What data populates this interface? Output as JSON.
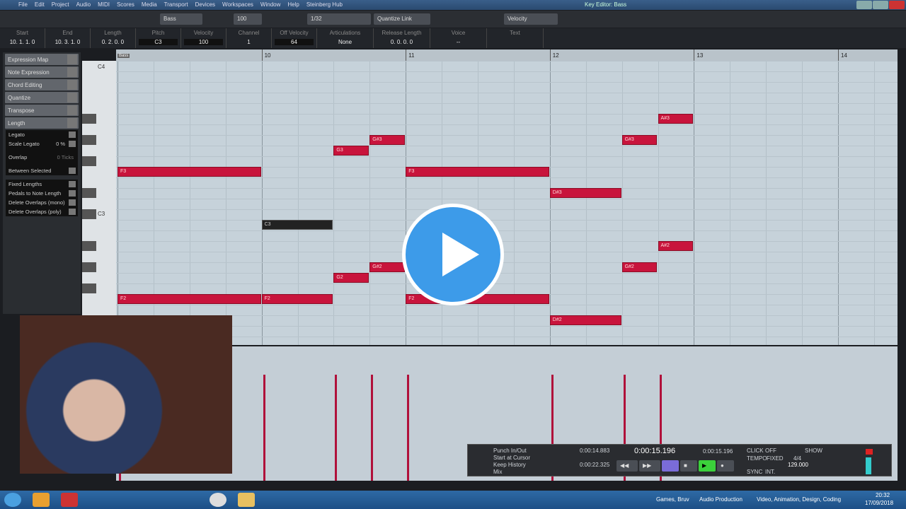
{
  "window": {
    "title": "Key Editor: Bass"
  },
  "menu": [
    "File",
    "Edit",
    "Project",
    "Audio",
    "MIDI",
    "Scores",
    "Media",
    "Transport",
    "Devices",
    "Workspaces",
    "Window",
    "Help",
    "Steinberg Hub"
  ],
  "toolbar": {
    "track": "Bass",
    "velocity": "100",
    "quantize": "1/32",
    "quantize_link": "Quantize Link",
    "controller": "Velocity"
  },
  "infoline": [
    {
      "label": "Start",
      "value": "10. 1. 1.   0"
    },
    {
      "label": "End",
      "value": "10. 3. 1.   0"
    },
    {
      "label": "Length",
      "value": "0. 2. 0.   0"
    },
    {
      "label": "Pitch",
      "value": "C3"
    },
    {
      "label": "Velocity",
      "value": "100"
    },
    {
      "label": "Channel",
      "value": "1"
    },
    {
      "label": "Off Velocity",
      "value": "64"
    },
    {
      "label": "Articulations",
      "value": "None"
    },
    {
      "label": "Release Length",
      "value": "0. 0. 0.   0"
    },
    {
      "label": "Voice",
      "value": "--"
    },
    {
      "label": "Text",
      "value": ""
    }
  ],
  "inspector": {
    "sections": [
      "Expression Map",
      "Note Expression",
      "Chord Editing",
      "Quantize",
      "Transpose",
      "Length"
    ],
    "length_rows": [
      "Legato",
      "Scale Legato",
      "Overlap",
      "Between Selected"
    ],
    "scale_legato": "0 %",
    "overlap": "0 Ticks",
    "functions": [
      "Fixed Lengths",
      "Pedals to Note Length",
      "Delete Overlaps (mono)",
      "Delete Overlaps (poly)"
    ]
  },
  "keys": {
    "c4": "C4",
    "c3": "C3"
  },
  "ruler": {
    "bars": [
      "10",
      "11",
      "12",
      "13",
      "14"
    ],
    "part": "Bass"
  },
  "notes": [
    {
      "pitch": "F3",
      "bar": 9,
      "beat": 1,
      "len": 4
    },
    {
      "pitch": "C3",
      "bar": 10,
      "beat": 1,
      "len": 2,
      "selected": true
    },
    {
      "pitch": "G3",
      "bar": 10,
      "beat": 3,
      "len": 1
    },
    {
      "pitch": "G#3",
      "bar": 10,
      "beat": 4,
      "len": 1
    },
    {
      "pitch": "F3",
      "bar": 11,
      "beat": 1,
      "len": 4
    },
    {
      "pitch": "D#3",
      "bar": 12,
      "beat": 1,
      "len": 2
    },
    {
      "pitch": "G#3",
      "bar": 12,
      "beat": 3,
      "len": 1
    },
    {
      "pitch": "A#3",
      "bar": 12,
      "beat": 4,
      "len": 1
    },
    {
      "pitch": "F2",
      "bar": 9,
      "beat": 1,
      "len": 4
    },
    {
      "pitch": "F2",
      "bar": 10,
      "beat": 1,
      "len": 2
    },
    {
      "pitch": "G2",
      "bar": 10,
      "beat": 3,
      "len": 1
    },
    {
      "pitch": "G#2",
      "bar": 10,
      "beat": 4,
      "len": 1
    },
    {
      "pitch": "F2",
      "bar": 11,
      "beat": 1,
      "len": 4
    },
    {
      "pitch": "D#2",
      "bar": 12,
      "beat": 1,
      "len": 2
    },
    {
      "pitch": "G#2",
      "bar": 12,
      "beat": 3,
      "len": 1
    },
    {
      "pitch": "A#2",
      "bar": 12,
      "beat": 4,
      "len": 1
    }
  ],
  "transport": {
    "options": [
      "Punch In/Out",
      "Start at Cursor",
      "Keep History",
      "Mix"
    ],
    "left_locator": "0:00:14.883",
    "right_locator": "0:00:22.325",
    "time": "0:00:15.196",
    "time2": "0:00:15.196",
    "click": "CLICK",
    "click_state": "OFF",
    "tempo": "TEMPO",
    "tempo_mode": "FIXED",
    "signature": "4/4",
    "bpm": "129.000",
    "sync": "SYNC",
    "sync_mode": "INT.",
    "show": "SHOW"
  },
  "taskbar": {
    "toolbars": [
      "Games, Bruv",
      "Audio Production",
      "Video, Animation, Design, Coding"
    ],
    "time": "20:32",
    "date": "17/09/2018"
  },
  "colors": {
    "note": "#c8143c",
    "play": "#3d9be9"
  }
}
